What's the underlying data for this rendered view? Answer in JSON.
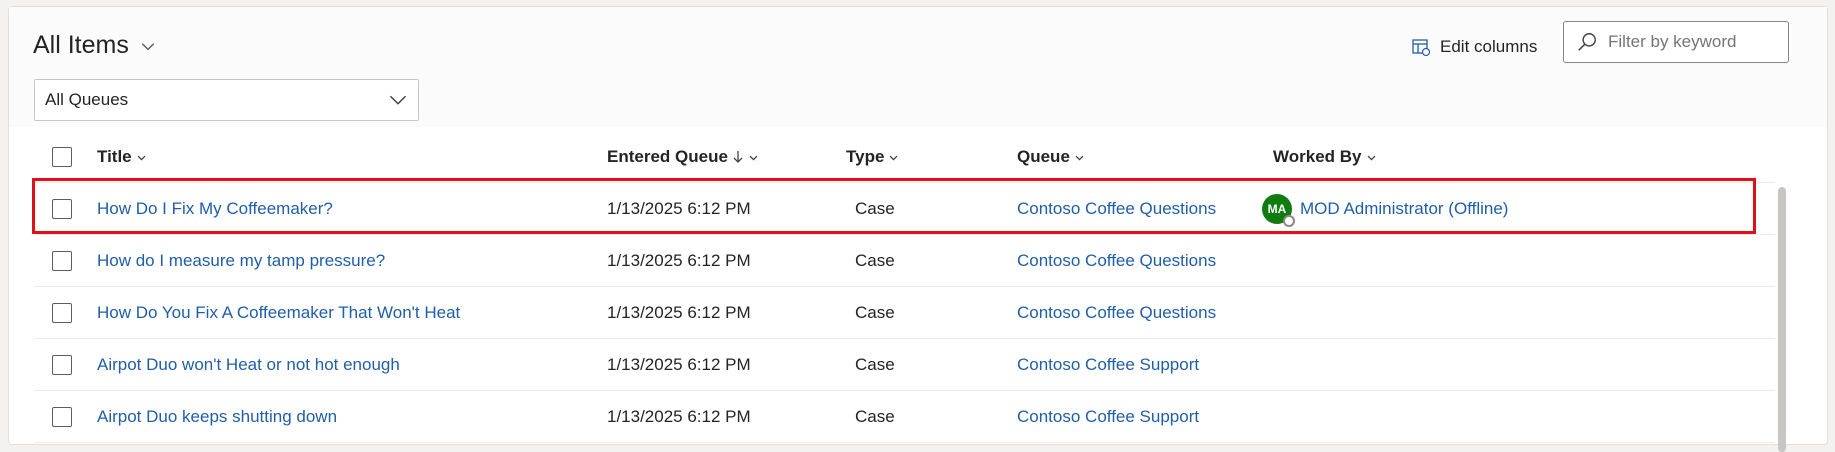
{
  "view": {
    "title": "All Items"
  },
  "queue_filter": {
    "selected": "All Queues"
  },
  "toolbar": {
    "edit_columns": "Edit columns",
    "filter_placeholder": "Filter by keyword"
  },
  "columns": {
    "title": "Title",
    "entered_queue": "Entered Queue",
    "type": "Type",
    "queue": "Queue",
    "worked_by": "Worked By"
  },
  "rows": [
    {
      "title": "How Do I Fix My Coffeemaker?",
      "entered": "1/13/2025 6:12 PM",
      "type": "Case",
      "queue": "Contoso Coffee Questions",
      "worked_by": "MOD Administrator (Offline)",
      "worked_by_initials": "MA"
    },
    {
      "title": "How do I measure my tamp pressure?",
      "entered": "1/13/2025 6:12 PM",
      "type": "Case",
      "queue": "Contoso Coffee Questions",
      "worked_by": ""
    },
    {
      "title": "How Do You Fix A Coffeemaker That Won't Heat",
      "entered": "1/13/2025 6:12 PM",
      "type": "Case",
      "queue": "Contoso Coffee Questions",
      "worked_by": ""
    },
    {
      "title": "Airpot Duo won't Heat or not hot enough",
      "entered": "1/13/2025 6:12 PM",
      "type": "Case",
      "queue": "Contoso Coffee Support",
      "worked_by": ""
    },
    {
      "title": "Airpot Duo keeps shutting down",
      "entered": "1/13/2025 6:12 PM",
      "type": "Case",
      "queue": "Contoso Coffee Support",
      "worked_by": ""
    }
  ],
  "colors": {
    "link": "#1f5ea8",
    "highlight": "#e0101a",
    "avatar": "#107c10"
  }
}
